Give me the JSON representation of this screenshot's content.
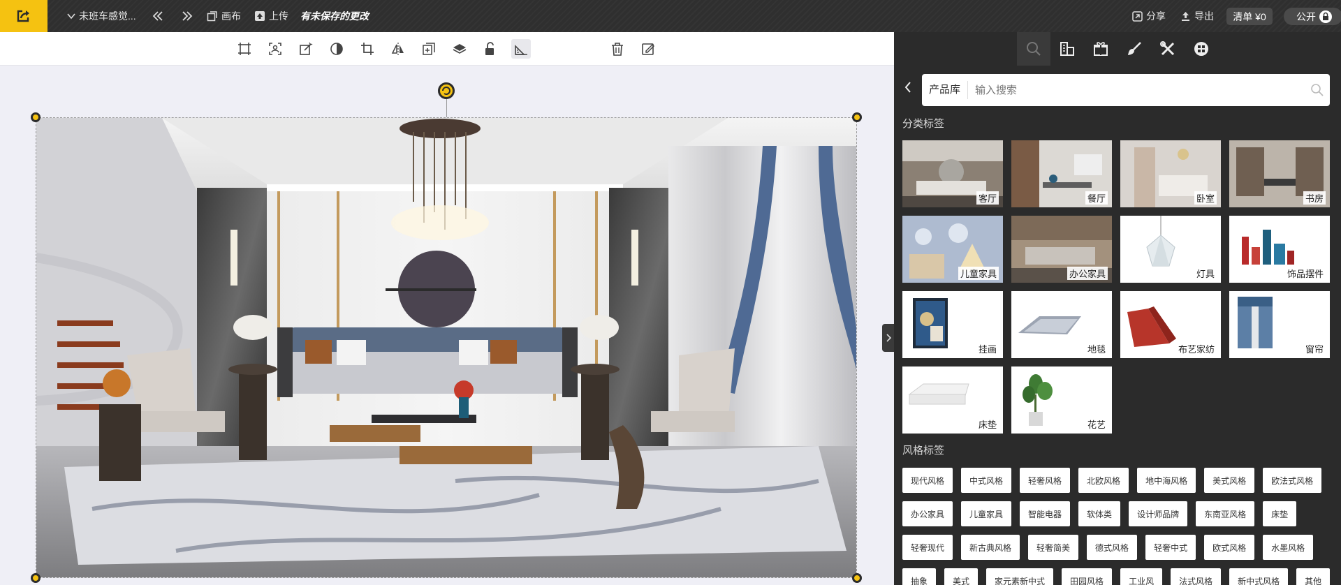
{
  "topbar": {
    "project_name": "未班车感觉...",
    "canvas_label": "画布",
    "upload_label": "上传",
    "unsaved_label": "有未保存的更改",
    "share_label": "分享",
    "export_label": "导出",
    "list_label": "清单 ¥0",
    "visibility_label": "公开"
  },
  "search": {
    "library_label": "产品库",
    "placeholder": "输入搜索"
  },
  "categories": {
    "title": "分类标签",
    "items": [
      "客厅",
      "餐厅",
      "卧室",
      "书房",
      "儿童家具",
      "办公家具",
      "灯具",
      "饰品摆件",
      "挂画",
      "地毯",
      "布艺家纺",
      "窗帘",
      "床垫",
      "花艺"
    ]
  },
  "styles": {
    "title": "风格标签",
    "rows": [
      [
        "现代风格",
        "中式风格",
        "轻奢风格",
        "北欧风格",
        "地中海风格",
        "美式风格",
        "欧法式风格"
      ],
      [
        "办公家具",
        "儿童家具",
        "智能电器",
        "软体类",
        "设计师品牌",
        "东南亚风格",
        "床垫"
      ],
      [
        "轻奢现代",
        "新古典风格",
        "轻奢简美",
        "德式风格",
        "轻奢中式",
        "欧式风格",
        "水墨风格"
      ],
      [
        "抽象",
        "美式",
        "家元素新中式",
        "田园风格",
        "工业风",
        "法式风格",
        "新中式风格",
        "其他"
      ]
    ]
  },
  "colors": {
    "accent": "#f5c211",
    "topbar": "#2f2f2f",
    "panel": "#2b2b2b",
    "canvas": "#efeff6"
  },
  "icons": {
    "edit_tools": [
      "select-frame-icon",
      "cutout-icon",
      "magic-edit-icon",
      "contrast-icon",
      "crop-icon",
      "flip-icon",
      "duplicate-icon",
      "layers-icon",
      "unlock-icon",
      "ruler-icon",
      "delete-icon",
      "note-icon"
    ],
    "panel_tabs": [
      "search-icon",
      "building-icon",
      "gift-icon",
      "brush-icon",
      "tools-icon",
      "grid-menu-icon"
    ]
  }
}
